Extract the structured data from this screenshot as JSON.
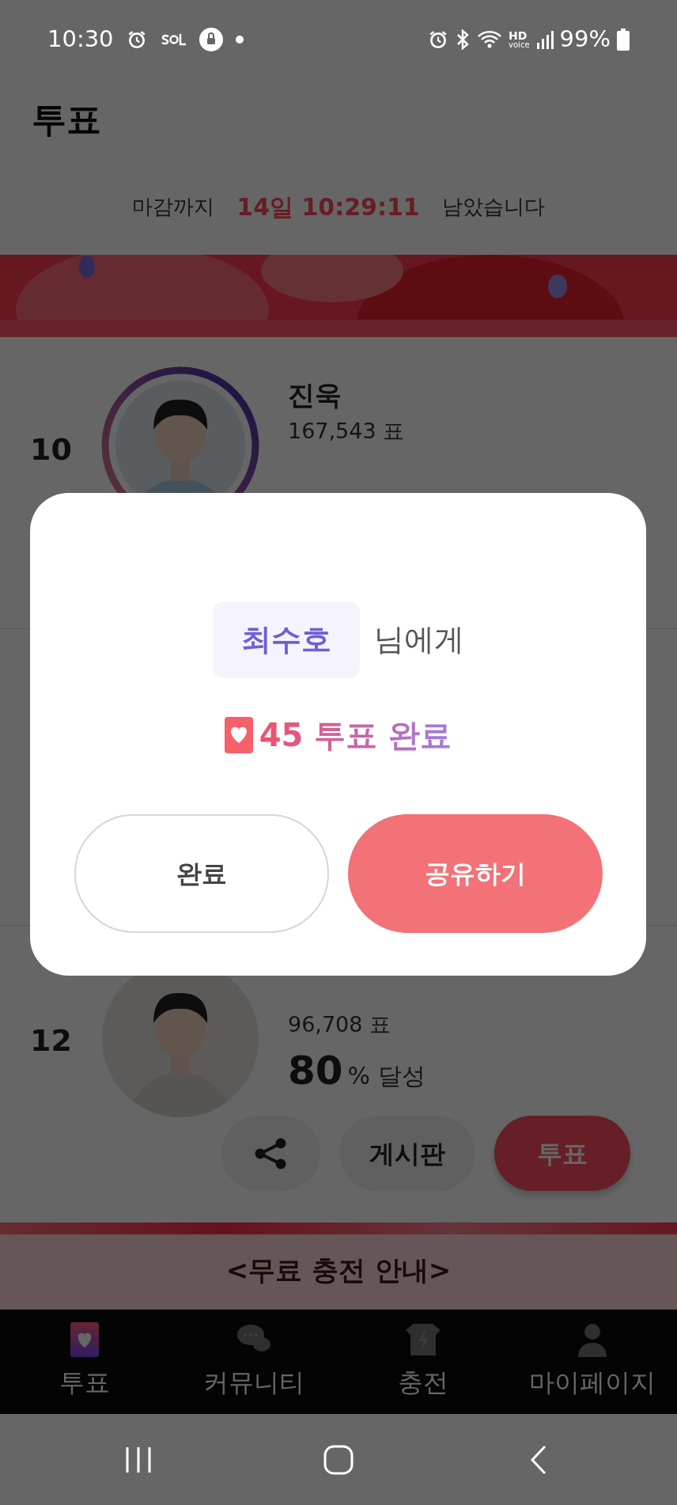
{
  "status_bar": {
    "time": "10:30",
    "hd": "HD",
    "voice": "voice",
    "battery": "99%"
  },
  "header": {
    "title": "투표"
  },
  "countdown": {
    "prefix": "마감까지",
    "remaining": "14일 10:29:11",
    "suffix": "남았습니다"
  },
  "candidates": [
    {
      "rank": "10",
      "name": "진욱",
      "votes": "167,543 표",
      "ring": true
    },
    {
      "rank": "12",
      "votes": "96,708 표",
      "percent": "80",
      "percent_unit": "%",
      "percent_label": "달성",
      "ring": false,
      "buttons": [
        {
          "kind": "share"
        },
        {
          "kind": "board",
          "label": "게시판"
        },
        {
          "kind": "vote",
          "label": "투표"
        }
      ]
    }
  ],
  "notice": {
    "title": "<무료 충전 안내>"
  },
  "bottom_nav": [
    {
      "label": "투표",
      "selected": true
    },
    {
      "label": "커뮤니티",
      "selected": false
    },
    {
      "label": "충전",
      "selected": false
    },
    {
      "label": "마이페이지",
      "selected": false
    }
  ],
  "dialog": {
    "recipient": "최수호",
    "recipient_suffix": "님에게",
    "result": "45 투표 완료",
    "buttons": [
      {
        "kind": "secondary",
        "label": "완료"
      },
      {
        "kind": "primary",
        "label": "공유하기"
      }
    ]
  }
}
